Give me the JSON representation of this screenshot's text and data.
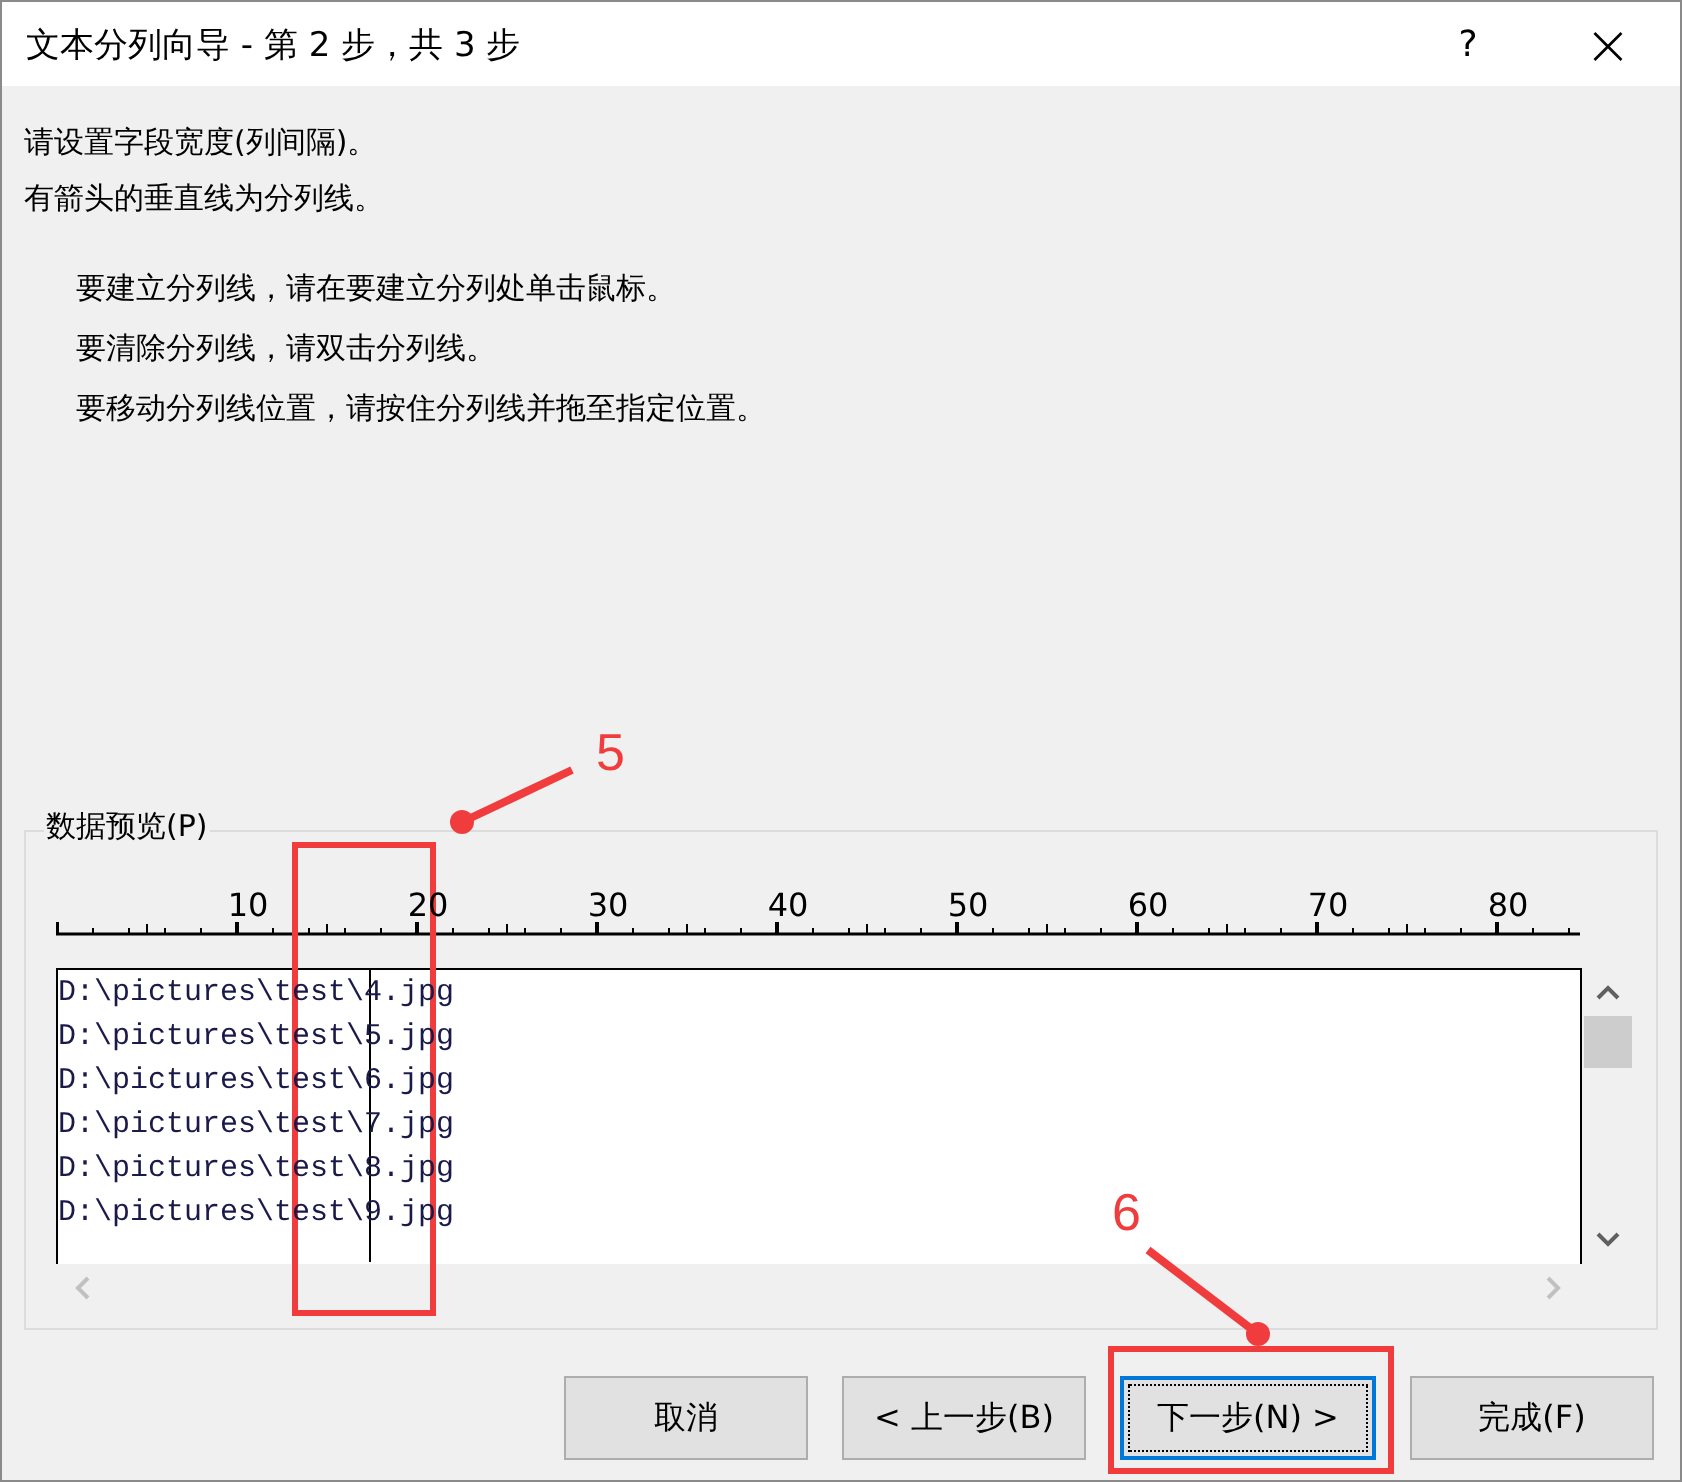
{
  "window": {
    "title": "文本分列向导 - 第 2 步，共 3 步",
    "help": "?",
    "close": "×"
  },
  "instructions": [
    "请设置字段宽度(列间隔)。",
    "有箭头的垂直线为分列线。"
  ],
  "hints": [
    "要建立分列线，请在要建立分列处单击鼠标。",
    "要清除分列线，请双击分列线。",
    "要移动分列线位置，请按住分列线并拖至指定位置。"
  ],
  "preview": {
    "label": "数据预览(P)",
    "ruler_labels": [
      "10",
      "20",
      "30",
      "40",
      "50",
      "60",
      "70",
      "80"
    ],
    "rows": [
      {
        "column_1": "D:\\pictures\\test\\",
        "column_2": "4.jpg"
      },
      {
        "column_1": "D:\\pictures\\test\\",
        "column_2": "5.jpg"
      },
      {
        "column_1": "D:\\pictures\\test\\",
        "column_2": "6.jpg"
      },
      {
        "column_1": "D:\\pictures\\test\\",
        "column_2": "7.jpg"
      },
      {
        "column_1": "D:\\pictures\\test\\",
        "column_2": "8.jpg"
      },
      {
        "column_1": "D:\\pictures\\test\\",
        "column_2": "9.jpg"
      }
    ]
  },
  "buttons": [
    {
      "label": "取消",
      "focused": false
    },
    {
      "label": "< 上一步(B)",
      "focused": false
    },
    {
      "label": "下一步(N) >",
      "focused": true
    },
    {
      "label": "完成(F)",
      "focused": false
    }
  ],
  "annotations": [
    {
      "label": "5"
    },
    {
      "label": "6"
    }
  ]
}
